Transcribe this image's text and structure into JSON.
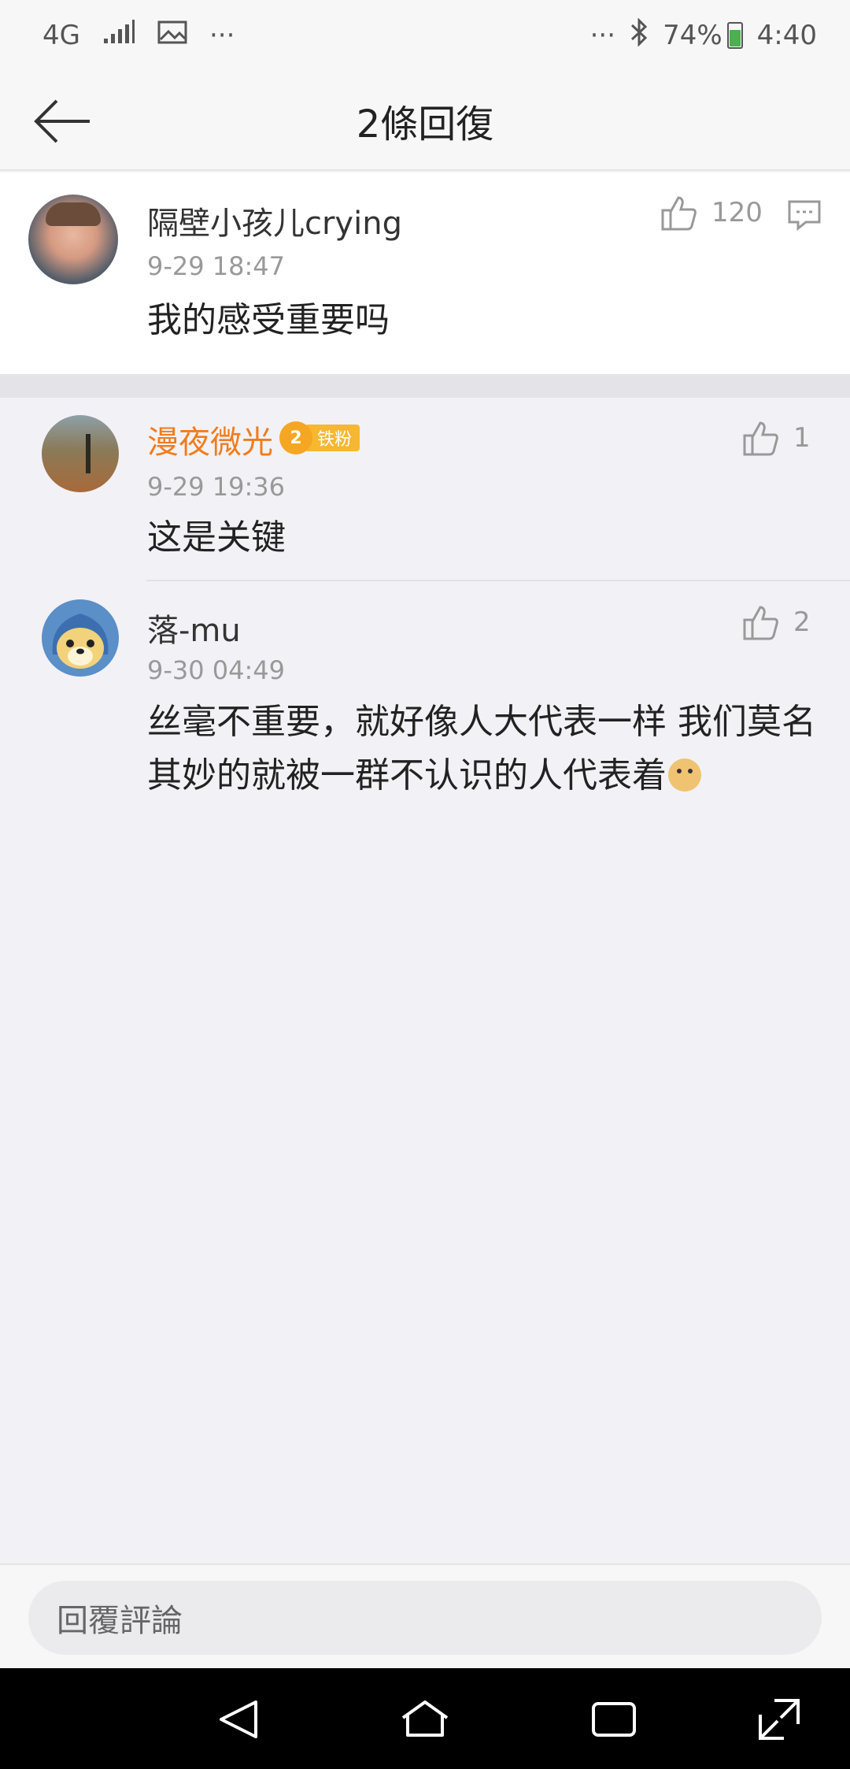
{
  "status_bar": {
    "network": "4G",
    "more_left": "···",
    "more_right": "···",
    "battery": "74%",
    "time": "4:40"
  },
  "header": {
    "title": "2條回復"
  },
  "main_comment": {
    "username": "隔壁小孩儿crying",
    "time": "9-29 18:47",
    "text": "我的感受重要吗",
    "likes": "120"
  },
  "replies": [
    {
      "username": "漫夜微光",
      "badge": "铁粉",
      "badge_level": "2",
      "time": "9-29 19:36",
      "text": "这是关键",
      "likes": "1"
    },
    {
      "username": "落-mu",
      "time": "9-30 04:49",
      "text_line1": "丝毫不重要，就好像人大代表一样  我们莫名",
      "text_line2": "其妙的就被一群不认识的人代表着",
      "likes": "2"
    }
  ],
  "input": {
    "placeholder": "回覆評論"
  },
  "colors": {
    "accent_orange": "#f07c1e",
    "badge_gold": "#f7b731",
    "background": "#f2f2f6"
  }
}
